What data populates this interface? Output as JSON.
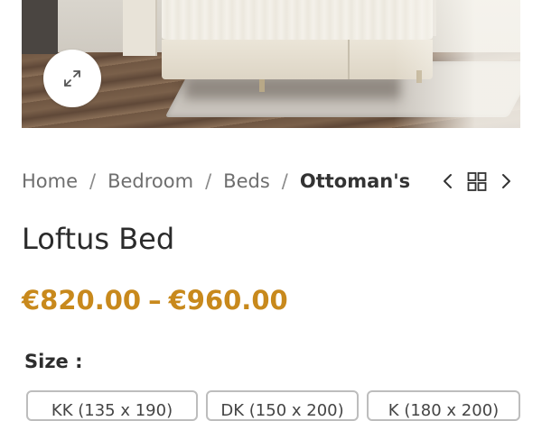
{
  "product_image": {
    "alt": "Loftus Bed product photo"
  },
  "zoom": {
    "icon": "expand-arrows-icon"
  },
  "breadcrumb": {
    "items": [
      "Home",
      "Bedroom",
      "Beds"
    ],
    "separator": "/",
    "current": "Ottoman's"
  },
  "product_nav": {
    "prev_icon": "chevron-left-icon",
    "grid_icon": "grid-icon",
    "next_icon": "chevron-right-icon"
  },
  "product": {
    "title": "Loftus Bed",
    "price_min": "€820.00",
    "price_sep": "–",
    "price_max": "€960.00"
  },
  "size": {
    "label": "Size",
    "label_suffix": " :",
    "options": [
      "KK (135 x 190)",
      "DK (150 x 200)",
      "K (180 x 200)"
    ]
  },
  "colors": {
    "accent": "#c8891c",
    "text": "#2d2d2d",
    "muted": "#6e6e6e"
  }
}
